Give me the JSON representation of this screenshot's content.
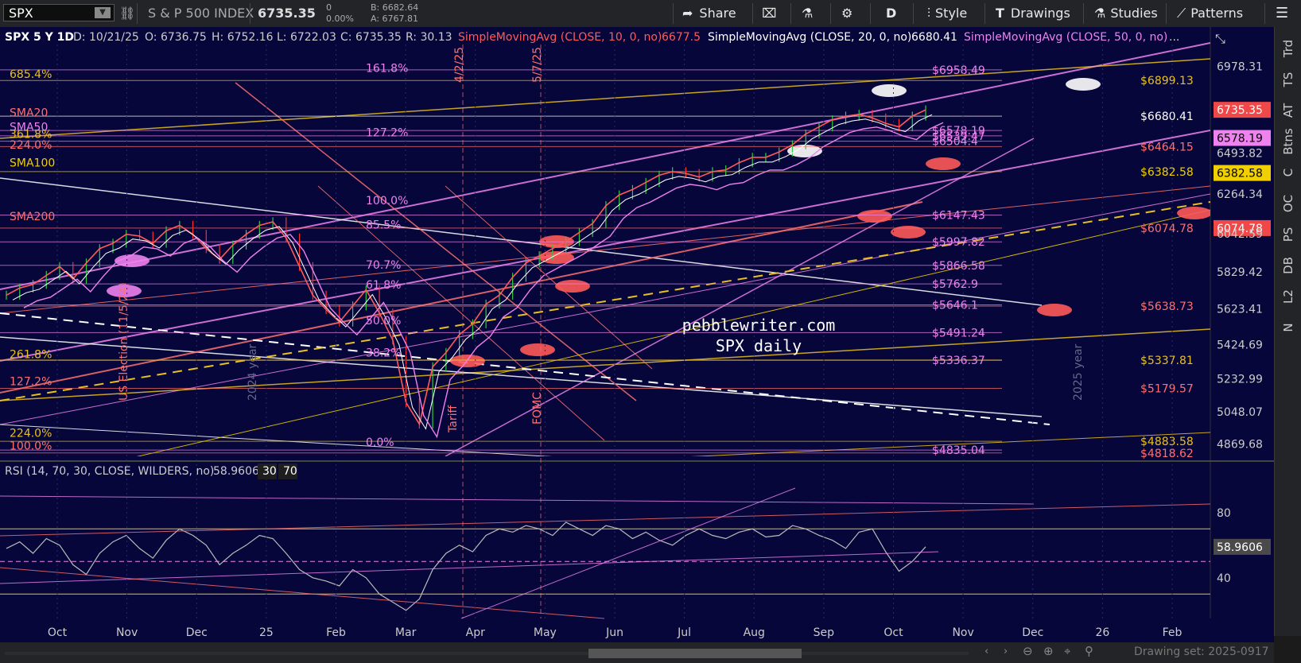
{
  "toolbar": {
    "symbol": "SPX",
    "description": "S & P 500 INDEX",
    "last": "6735.35",
    "change": "0",
    "change_pct": "0.00%",
    "bid": "B: 6682.64",
    "ask": "A: 6767.81",
    "share": "Share",
    "period": "D",
    "style": "Style",
    "drawings": "Drawings",
    "studies": "Studies",
    "patterns": "Patterns"
  },
  "side_tabs": [
    "Trd",
    "TS",
    "AT",
    "Btns",
    "C",
    "OC",
    "PS",
    "DB",
    "L2",
    "N"
  ],
  "chart_data": {
    "type": "line",
    "title": "SPX 5 Y 1D",
    "header": {
      "date": "D: 10/21/25",
      "open": "O: 6736.75",
      "high": "H: 6752.16",
      "low": "L: 6722.03",
      "close": "C: 6735.35",
      "range": "R: 30.13",
      "sma10_label": "SimpleMovingAvg (CLOSE, 10, 0, no)",
      "sma10_value": "6677.5",
      "sma20_label": "SimpleMovingAvg (CLOSE, 20, 0, no)",
      "sma20_value": "6680.41",
      "sma50_label": "SimpleMovingAvg (CLOSE, 50, 0, no)"
    },
    "watermark": [
      "pebblewriter.com",
      "SPX daily"
    ],
    "x_ticks": [
      "Oct",
      "Nov",
      "Dec",
      "25",
      "Feb",
      "Mar",
      "Apr",
      "May",
      "Jun",
      "Jul",
      "Aug",
      "Sep",
      "Oct",
      "Nov",
      "Dec",
      "26",
      "Feb"
    ],
    "y_ticks": [
      "6978.31",
      "6493.82",
      "6264.34",
      "6042.59",
      "5829.42",
      "5623.41",
      "5424.69",
      "5232.99",
      "5048.07",
      "4869.68"
    ],
    "y_range": [
      4800,
      7100
    ],
    "price_badges": [
      {
        "label": "6735.35",
        "value": 6735.35,
        "bg": "#f04848",
        "fg": "#ffffff"
      },
      {
        "label": "6578.19",
        "value": 6578.19,
        "bg": "#ee82ee",
        "fg": "#000000"
      },
      {
        "label": "6382.58",
        "value": 6382.58,
        "bg": "#f0d000",
        "fg": "#000000"
      },
      {
        "label": "6074.78",
        "value": 6074.78,
        "bg": "#f04848",
        "fg": "#ffffff"
      }
    ],
    "left_labels": [
      {
        "text": "685.4%",
        "value": 6935,
        "color": "#e8c020"
      },
      {
        "text": "SMA20",
        "value": 6720,
        "color": "#ff7070"
      },
      {
        "text": "SMA50",
        "value": 6640,
        "color": "#ee82ee"
      },
      {
        "text": "361.8%",
        "value": 6600,
        "color": "#e8c020"
      },
      {
        "text": "224.0%",
        "value": 6540,
        "color": "#ff7070"
      },
      {
        "text": "SMA100",
        "value": 6440,
        "color": "#f0d000"
      },
      {
        "text": "SMA200",
        "value": 6140,
        "color": "#ff7070"
      },
      {
        "text": "261.8%",
        "value": 5370,
        "color": "#e8c020"
      },
      {
        "text": "127.2%",
        "value": 5220,
        "color": "#ff7070"
      },
      {
        "text": "224.0%",
        "value": 4930,
        "color": "#e8c020"
      },
      {
        "text": "100.0%",
        "value": 4860,
        "color": "#ff7070"
      }
    ],
    "fib_labels": [
      "161.8%",
      "127.2%",
      "100.0%",
      "85.5%",
      "70.7%",
      "61.8%",
      "50.0%",
      "38.2%",
      "0.0%"
    ],
    "fib_values": [
      6970,
      6610,
      6230,
      6095,
      5870,
      5760,
      5560,
      5380,
      4880
    ],
    "right_levels": [
      {
        "text": "$6958.49",
        "value": 6958.49,
        "color": "#ee82ee"
      },
      {
        "text": "$6899.13",
        "value": 6899.13,
        "color": "#e8c020"
      },
      {
        "text": "$6680.41",
        "value": 6700,
        "color": "#ffffff"
      },
      {
        "text": "$6578.19",
        "value": 6620,
        "color": "#ee82ee"
      },
      {
        "text": "$6539.47",
        "value": 6590,
        "color": "#ee82ee"
      },
      {
        "text": "$6504.4",
        "value": 6560,
        "color": "#ee82ee"
      },
      {
        "text": "$6464.15",
        "value": 6530,
        "color": "#ff7070"
      },
      {
        "text": "$6382.58",
        "value": 6390,
        "color": "#f0d000"
      },
      {
        "text": "$6147.43",
        "value": 6147.43,
        "color": "#ee82ee"
      },
      {
        "text": "$6074.78",
        "value": 6074.78,
        "color": "#ff7070"
      },
      {
        "text": "$5997.82",
        "value": 5997.82,
        "color": "#ee82ee"
      },
      {
        "text": "$5866.58",
        "value": 5866.58,
        "color": "#ee82ee"
      },
      {
        "text": "$5762.9",
        "value": 5762.9,
        "color": "#ee82ee"
      },
      {
        "text": "$5646.1",
        "value": 5646.1,
        "color": "#ee82ee"
      },
      {
        "text": "$5638.73",
        "value": 5638.73,
        "color": "#ff7070"
      },
      {
        "text": "$5491.24",
        "value": 5491.24,
        "color": "#ee82ee"
      },
      {
        "text": "$5336.37",
        "value": 5336.37,
        "color": "#ee82ee"
      },
      {
        "text": "$5337.81",
        "value": 5337.81,
        "color": "#e8c020"
      },
      {
        "text": "$5179.57",
        "value": 5179.57,
        "color": "#ff7070"
      },
      {
        "text": "$4883.58",
        "value": 4883.58,
        "color": "#e8c020"
      },
      {
        "text": "$4835.04",
        "value": 4835.04,
        "color": "#ee82ee"
      },
      {
        "text": "$4818.62",
        "value": 4818.62,
        "color": "#ff7070"
      }
    ],
    "vertical_labels": [
      "4/2/25",
      "5/7/25",
      "US Election (11/5/24)",
      "2024 year",
      "Tariff",
      "FOMC",
      "2025 year"
    ],
    "price_series": [
      5700,
      5740,
      5760,
      5810,
      5860,
      5790,
      5880,
      5960,
      5990,
      6040,
      6030,
      5990,
      6060,
      6090,
      6040,
      5960,
      5900,
      5980,
      6040,
      6090,
      6110,
      6020,
      5860,
      5700,
      5620,
      5550,
      5640,
      5730,
      5600,
      5450,
      5100,
      4980,
      5300,
      5380,
      5480,
      5540,
      5650,
      5700,
      5800,
      5880,
      5920,
      5960,
      6000,
      6050,
      6100,
      6200,
      6260,
      6290,
      6330,
      6370,
      6390,
      6380,
      6360,
      6390,
      6400,
      6440,
      6470,
      6470,
      6500,
      6540,
      6600,
      6640,
      6680,
      6700,
      6710,
      6690,
      6660,
      6640,
      6700,
      6735
    ],
    "rsi": {
      "label": "RSI (14, 70, 30, CLOSE, WILDERS, no)",
      "value": "58.9606",
      "levels": [
        "30",
        "70"
      ],
      "y_ticks": [
        "80",
        "40"
      ],
      "y_range": [
        15,
        95
      ],
      "values": [
        58,
        62,
        55,
        64,
        60,
        48,
        42,
        55,
        62,
        66,
        58,
        52,
        63,
        70,
        66,
        60,
        48,
        55,
        60,
        66,
        64,
        55,
        45,
        40,
        38,
        35,
        45,
        40,
        30,
        25,
        20,
        27,
        45,
        55,
        60,
        56,
        66,
        70,
        68,
        72,
        70,
        66,
        74,
        70,
        66,
        72,
        70,
        64,
        68,
        63,
        60,
        66,
        70,
        66,
        64,
        68,
        70,
        65,
        66,
        72,
        70,
        66,
        63,
        58,
        68,
        70,
        56,
        44,
        50,
        59
      ]
    }
  },
  "footer": {
    "drawing_set": "Drawing set: 2025-0917"
  }
}
